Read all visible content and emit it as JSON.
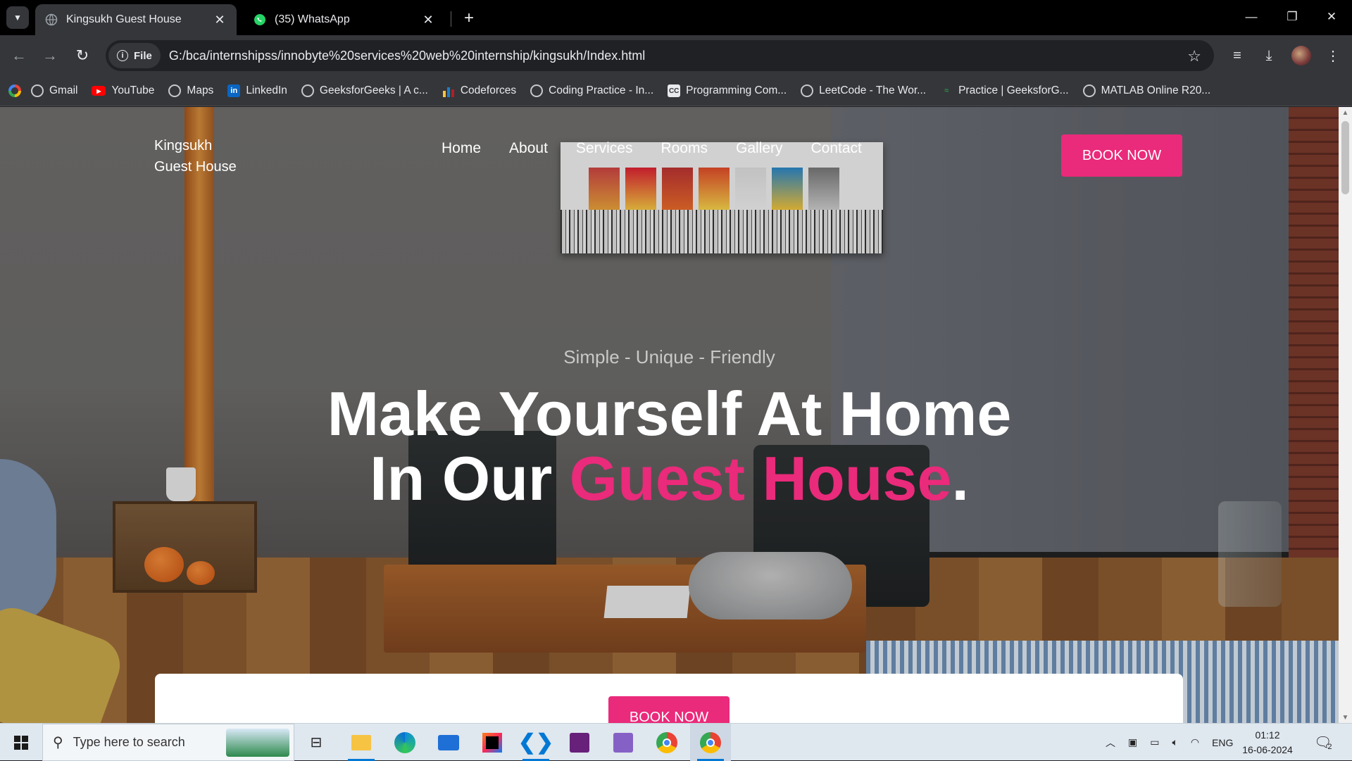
{
  "browser": {
    "tabs": [
      {
        "title": "Kingsukh Guest House",
        "active": true
      },
      {
        "title": "(35) WhatsApp",
        "active": false
      }
    ],
    "site_info_label": "File",
    "url": "G:/bca/internshipss/innobyte%20services%20web%20internship/kingsukh/Index.html",
    "bookmarks": [
      {
        "label": "Gmail",
        "icon": "globe-icon"
      },
      {
        "label": "YouTube",
        "icon": "youtube-icon"
      },
      {
        "label": "Maps",
        "icon": "globe-icon"
      },
      {
        "label": "LinkedIn",
        "icon": "linkedin-icon"
      },
      {
        "label": "GeeksforGeeks | A c...",
        "icon": "globe-icon"
      },
      {
        "label": "Codeforces",
        "icon": "codeforces-icon"
      },
      {
        "label": "Coding Practice - In...",
        "icon": "globe-icon"
      },
      {
        "label": "Programming Com...",
        "icon": "codechef-icon"
      },
      {
        "label": "LeetCode - The Wor...",
        "icon": "globe-icon"
      },
      {
        "label": "Practice | GeeksforG...",
        "icon": "gfg-icon"
      },
      {
        "label": "MATLAB Online R20...",
        "icon": "globe-icon"
      }
    ]
  },
  "site": {
    "logo_line1": "Kingsukh",
    "logo_line2": "Guest House",
    "nav": [
      "Home",
      "About",
      "Services",
      "Rooms",
      "Gallery",
      "Contact"
    ],
    "book_now": "BOOK NOW",
    "tagline": "Simple - Unique - Friendly",
    "headline_line1": "Make Yourself At Home",
    "headline_line2_prefix": "In Our ",
    "headline_line2_accent": "Guest House",
    "headline_line2_suffix": ".",
    "card_button": "BOOK NOW",
    "accent_color": "#ea2a7a"
  },
  "taskbar": {
    "search_placeholder": "Type here to search",
    "language": "ENG",
    "time": "01:12",
    "date": "16-06-2024",
    "notification_count": "2"
  }
}
